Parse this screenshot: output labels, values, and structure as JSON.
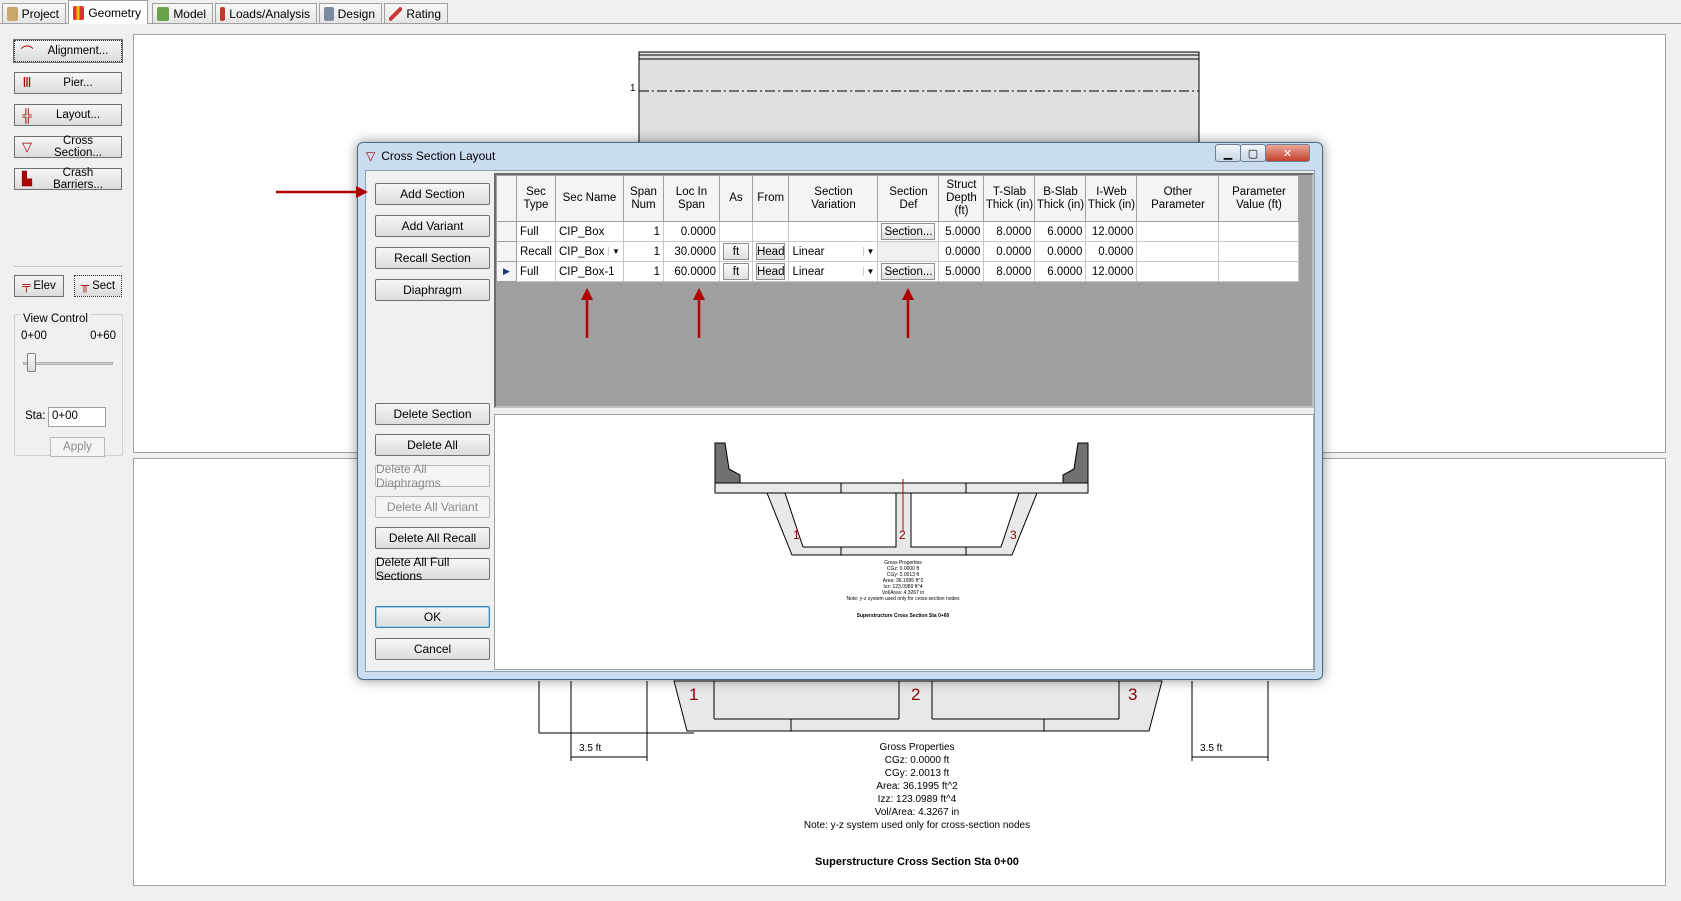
{
  "tabs": [
    {
      "label": "Project",
      "icon": "project-icon",
      "active": false
    },
    {
      "label": "Geometry",
      "icon": "geometry-icon",
      "active": true
    },
    {
      "label": "Model",
      "icon": "model-icon",
      "active": false
    },
    {
      "label": "Loads/Analysis",
      "icon": "loads-icon",
      "active": false
    },
    {
      "label": "Design",
      "icon": "design-icon",
      "active": false
    },
    {
      "label": "Rating",
      "icon": "rating-icon",
      "active": false
    }
  ],
  "sidebar": {
    "buttons": [
      "Alignment...",
      "Pier...",
      "Layout...",
      "Cross Section...",
      "Crash Barriers..."
    ],
    "elev_label": "Elev",
    "sect_label": "Sect",
    "view_control": {
      "title": "View Control",
      "min_label": "0+00",
      "max_label": "0+60",
      "sta_label": "Sta:",
      "sta_value": "0+00",
      "apply_label": "Apply"
    }
  },
  "top_canvas": {
    "lane_label": "1"
  },
  "bottom_canvas": {
    "cell_labels": [
      "1",
      "2",
      "3"
    ],
    "dim_left": "3.5 ft",
    "dim_right": "3.5 ft",
    "props_title": "Gross Properties",
    "props": [
      "CGz:  0.0000 ft",
      "CGy:  2.0013 ft",
      "Area:  36.1995 ft^2",
      "Izz:  123.0989 ft^4",
      "Vol/Area:  4.3267 in",
      "Note: y-z system used only for cross-section nodes"
    ],
    "caption": "Superstructure Cross Section Sta 0+00"
  },
  "dialog": {
    "title": "Cross Section Layout",
    "buttons_top": [
      "Add Section",
      "Add Variant",
      "Recall Section",
      "Diaphragm"
    ],
    "buttons_bottom": [
      {
        "label": "Delete Section",
        "enabled": true
      },
      {
        "label": "Delete All",
        "enabled": true
      },
      {
        "label": "Delete All Diaphragms",
        "enabled": false
      },
      {
        "label": "Delete All Variant",
        "enabled": false
      },
      {
        "label": "Delete All Recall",
        "enabled": true
      },
      {
        "label": "Delete All Full Sections",
        "enabled": true
      }
    ],
    "ok_label": "OK",
    "cancel_label": "Cancel",
    "columns": [
      "Sec Type",
      "Sec Name",
      "Span Num",
      "Loc In Span",
      "As",
      "From",
      "Section Variation",
      "Section Def",
      "Struct Depth (ft)",
      "T-Slab Thick (in)",
      "B-Slab Thick (in)",
      "I-Web Thick (in)",
      "Other Parameter",
      "Parameter Value (ft)"
    ],
    "rows": [
      {
        "type": "Full",
        "name": "CIP_Box",
        "span": "1",
        "loc": "0.0000",
        "as": "",
        "from": "",
        "variation": "",
        "def": "Section...",
        "depth": "5.0000",
        "tslab": "8.0000",
        "bslab": "6.0000",
        "iweb": "12.0000",
        "other": "",
        "param": ""
      },
      {
        "type": "Recall",
        "name": "CIP_Box",
        "span": "1",
        "loc": "30.0000",
        "as": "ft",
        "from": "Head",
        "variation": "Linear",
        "def": "",
        "depth": "0.0000",
        "tslab": "0.0000",
        "bslab": "0.0000",
        "iweb": "0.0000",
        "other": "",
        "param": ""
      },
      {
        "type": "Full",
        "name": "CIP_Box-1",
        "span": "1",
        "loc": "60.0000",
        "as": "ft",
        "from": "Head",
        "variation": "Linear",
        "def": "Section...",
        "depth": "5.0000",
        "tslab": "8.0000",
        "bslab": "6.0000",
        "iweb": "12.0000",
        "other": "",
        "param": ""
      }
    ],
    "preview": {
      "cell_labels": [
        "1",
        "2",
        "3"
      ],
      "props": [
        "Gross Properties",
        "CGz: 0.0000 ft",
        "CGy: 2.0013 ft",
        "Area: 36.1995 ft^2",
        "Izz: 123.0989 ft^4",
        "Vol/Area: 4.3267 in",
        "Note: y-z system used only for cross-section nodes"
      ],
      "caption": "Superstructure Cross Section Sta 0+60"
    }
  },
  "colors": {
    "accent": "#a00000",
    "grid_empty": "#a0a0a0",
    "dialog_frame": "#c9dcf0"
  }
}
